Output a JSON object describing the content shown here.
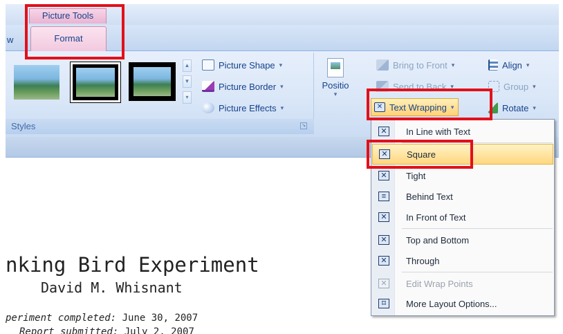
{
  "context_tab": {
    "header": "Picture Tools",
    "tab": "Format"
  },
  "tab_fragment": "w",
  "ribbon": {
    "picture_styles": {
      "commands": [
        {
          "label": "Picture Shape",
          "icon": "picture-shape-icon"
        },
        {
          "label": "Picture Border",
          "icon": "picture-border-icon"
        },
        {
          "label": "Picture Effects",
          "icon": "picture-effects-icon"
        }
      ],
      "group_label": "Styles"
    },
    "arrange": {
      "position_label": "Positio",
      "bring_to_front": "Bring to Front",
      "send_to_back": "Send to Back",
      "text_wrapping": "Text Wrapping",
      "align": "Align",
      "group": "Group",
      "rotate": "Rotate"
    }
  },
  "menu": {
    "items": [
      {
        "label": "In Line with Text",
        "icon": "inline-wrap-icon",
        "state": "normal"
      },
      {
        "label": "Square",
        "icon": "square-wrap-icon",
        "state": "highlighted"
      },
      {
        "label": "Tight",
        "icon": "tight-wrap-icon",
        "state": "normal"
      },
      {
        "label": "Behind Text",
        "icon": "behind-text-icon",
        "state": "normal"
      },
      {
        "label": "In Front of Text",
        "icon": "in-front-of-text-icon",
        "state": "normal"
      },
      {
        "label": "Top and Bottom",
        "icon": "top-bottom-wrap-icon",
        "state": "normal"
      },
      {
        "label": "Through",
        "icon": "through-wrap-icon",
        "state": "normal"
      },
      {
        "label": "Edit Wrap Points",
        "icon": "edit-wrap-points-icon",
        "state": "disabled"
      },
      {
        "label": "More Layout Options...",
        "icon": "layout-options-icon",
        "state": "normal"
      }
    ]
  },
  "document": {
    "title": "nking Bird Experiment",
    "author": "David M. Whisnant",
    "line1_label": "periment completed:",
    "line1_value": " June 30, 2007",
    "line2_label": "Report submitted:",
    "line2_value": " July 2, 2007"
  },
  "colors": {
    "highlight": "#ffd780",
    "callout": "#e2101a",
    "tab_context": "#f2c9df"
  }
}
